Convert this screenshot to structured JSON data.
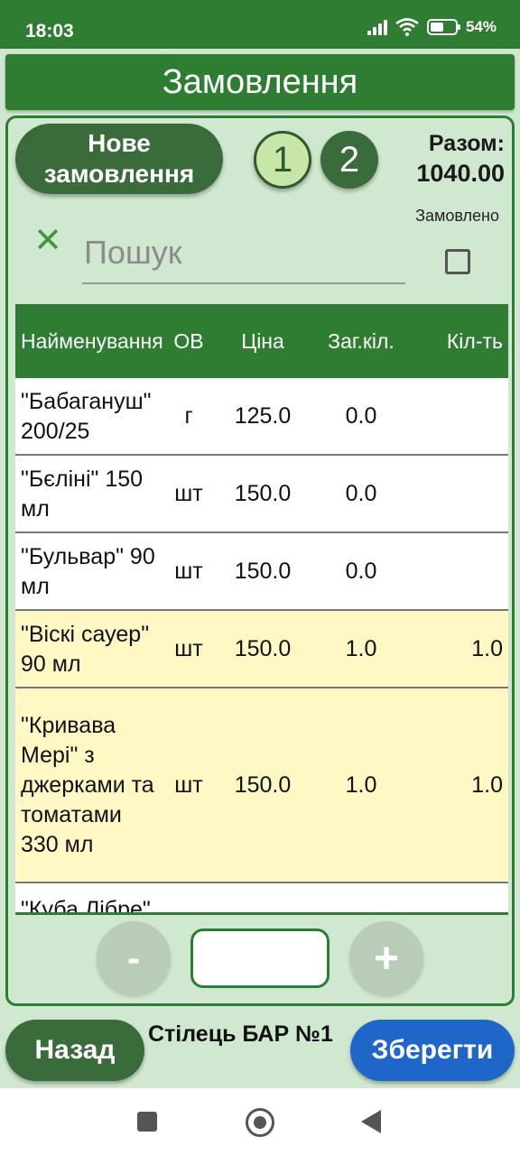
{
  "status_bar": {
    "time": "18:03",
    "battery": "54%",
    "battery_level": 0.54,
    "icons": [
      "signal-icon",
      "wifi-icon",
      "battery-icon"
    ]
  },
  "title": "Замовлення",
  "header": {
    "new_order_label": "Нове замовлення",
    "tabs": [
      "1",
      "2"
    ],
    "total_label": "Разом:",
    "total_value": "1040.00",
    "ordered_label": "Замовлено"
  },
  "search": {
    "placeholder": "Пошук",
    "value": ""
  },
  "table": {
    "columns": [
      "Найменування",
      "ОВ",
      "Ціна",
      "Заг.кіл.",
      "Кіл-ть"
    ],
    "rows": [
      {
        "name": "\"Бабагануш\" 200/25",
        "unit": "г",
        "price": "125.0",
        "total_qty": "0.0",
        "qty": ""
      },
      {
        "name": "\"Бєліні\" 150 мл",
        "unit": "шт",
        "price": "150.0",
        "total_qty": "0.0",
        "qty": ""
      },
      {
        "name": "\"Бульвар\" 90 мл",
        "unit": "шт",
        "price": "150.0",
        "total_qty": "0.0",
        "qty": ""
      },
      {
        "name": "\"Віскі сауер\" 90 мл",
        "unit": "шт",
        "price": "150.0",
        "total_qty": "1.0",
        "qty": "1.0"
      },
      {
        "name": "\"Кривава Мері\" з джерками та томатами 330 мл",
        "unit": "шт",
        "price": "150.0",
        "total_qty": "1.0",
        "qty": "1.0"
      },
      {
        "name": "\"Куба Лібре\"",
        "unit": "",
        "price": "",
        "total_qty": "",
        "qty": ""
      }
    ]
  },
  "stepper": {
    "minus_label": "-",
    "plus_label": "+",
    "value": ""
  },
  "footer": {
    "back_label": "Назад",
    "table_label": "Стілець БАР №1",
    "save_label": "Зберегти"
  },
  "colors": {
    "primary": "#2e7d32",
    "dark_button": "#3a6b3a",
    "background": "#cfe8cf",
    "highlight_row": "#fff7c4",
    "save_button": "#1e66c8"
  }
}
